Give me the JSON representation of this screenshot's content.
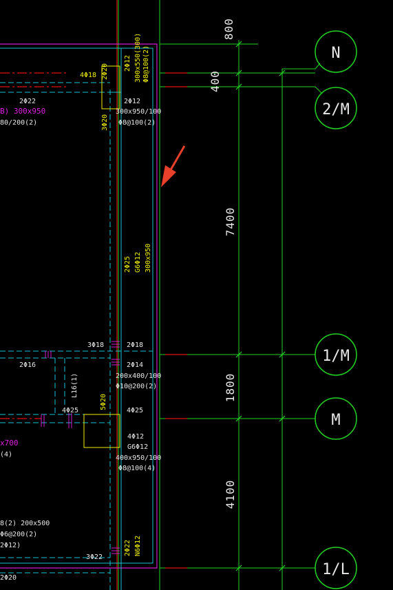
{
  "axis_labels": [
    "N",
    "2/M",
    "1/M",
    "M",
    "1/L"
  ],
  "dimensions": [
    "800",
    "400",
    "7400",
    "1800",
    "4100"
  ],
  "annotations": {
    "beam_top_left": "4Φ18",
    "col_top_a": "2Φ20",
    "col_top_b": "2Φ12",
    "col_top_c": "300x550(300)",
    "col_top_d": "Φ8@100(2)",
    "beam_mid_2phi22": "2Φ22",
    "beam_mag_1": "B) 300x950",
    "beam_mag_1b": "80/200(2)",
    "col_3phi20": "3Φ20",
    "sec_300x950": "300x950/100",
    "sec_phi8": "Φ8@100(2)",
    "vert_2phi25": "2Φ25",
    "vert_g6": "G6Φ12",
    "vert_300x950": "300x950",
    "j_3phi18": "3Φ18",
    "j_2phi18": "2Φ18",
    "b_2phi16": "2Φ16",
    "b_2phi14": "2Φ14",
    "b_200x400": "200x400/100",
    "b_phi10": "Φ10@200(2)",
    "l16": "L16(1)",
    "b_4phi25_a": "4Φ25",
    "b_5phi20": "5Φ20",
    "b_4phi25_b": "4Φ25",
    "m_x700": "x700",
    "m_4": "(4)",
    "c_4phi12": "4Φ12",
    "c_g6": "G6Φ12",
    "c_400x950": "400x950/100",
    "c_phi8_4": "Φ8@100(4)",
    "l_8_2": "8(2) 200x500",
    "l_6_200": "Φ6@200(2)",
    "l_2phi12": "2Φ12)",
    "v_2phi22": "2Φ22",
    "v_n6": "N6Φ12",
    "b_3phi22": "3Φ22",
    "b_2phi20": "2Φ20"
  },
  "colors": {
    "background": "#000000",
    "grid": "#22d422",
    "wall": "#19c4d4",
    "frame": "#d21ad2",
    "rebar": "#f0f000",
    "axis_tick": "#e01010",
    "arrow": "#e8402a"
  }
}
